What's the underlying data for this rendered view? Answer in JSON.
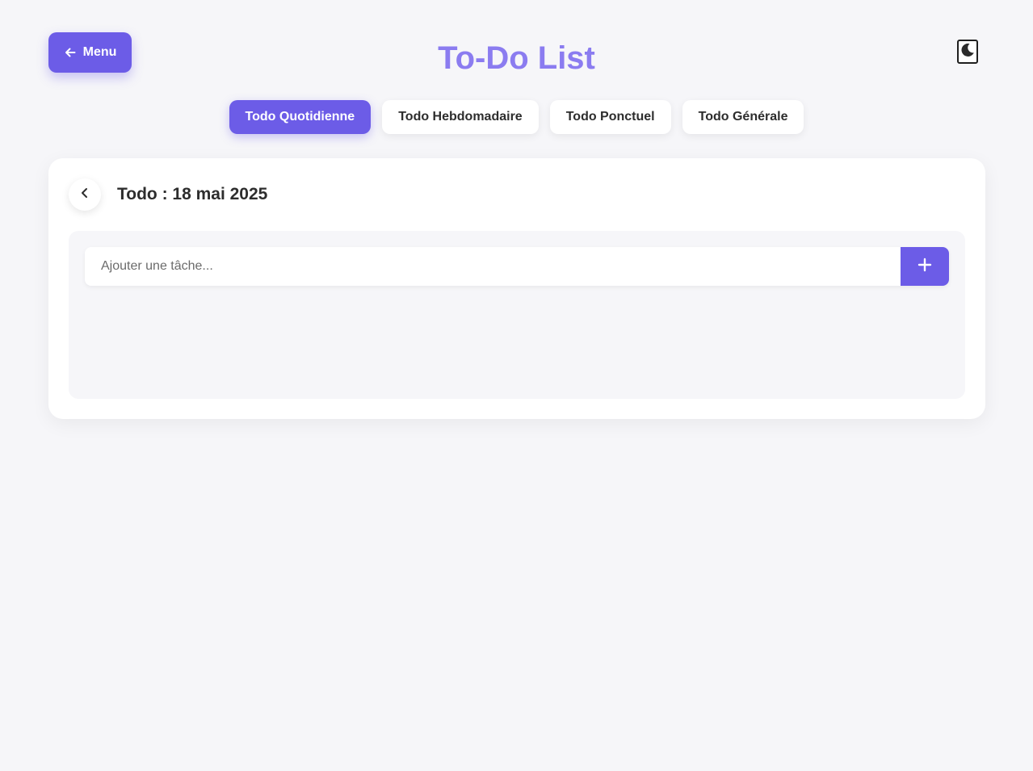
{
  "header": {
    "menu_label": "Menu",
    "menu_icon": "arrow-left-icon",
    "title": "To-Do List",
    "theme_icon": "moon-icon"
  },
  "tabs": [
    {
      "label": "Todo Quotidienne",
      "active": true
    },
    {
      "label": "Todo Hebdomadaire",
      "active": false
    },
    {
      "label": "Todo Ponctuel",
      "active": false
    },
    {
      "label": "Todo Générale",
      "active": false
    }
  ],
  "card": {
    "title": "Todo : 18 mai 2025",
    "back_icon": "chevron-left-icon",
    "input": {
      "value": "",
      "placeholder": "Ajouter une tâche..."
    },
    "add_icon": "plus-icon",
    "tasks": []
  },
  "colors": {
    "accent": "#6c5ce7",
    "title": "#8b7cf0",
    "background": "#f6f6f9",
    "card": "#ffffff"
  }
}
